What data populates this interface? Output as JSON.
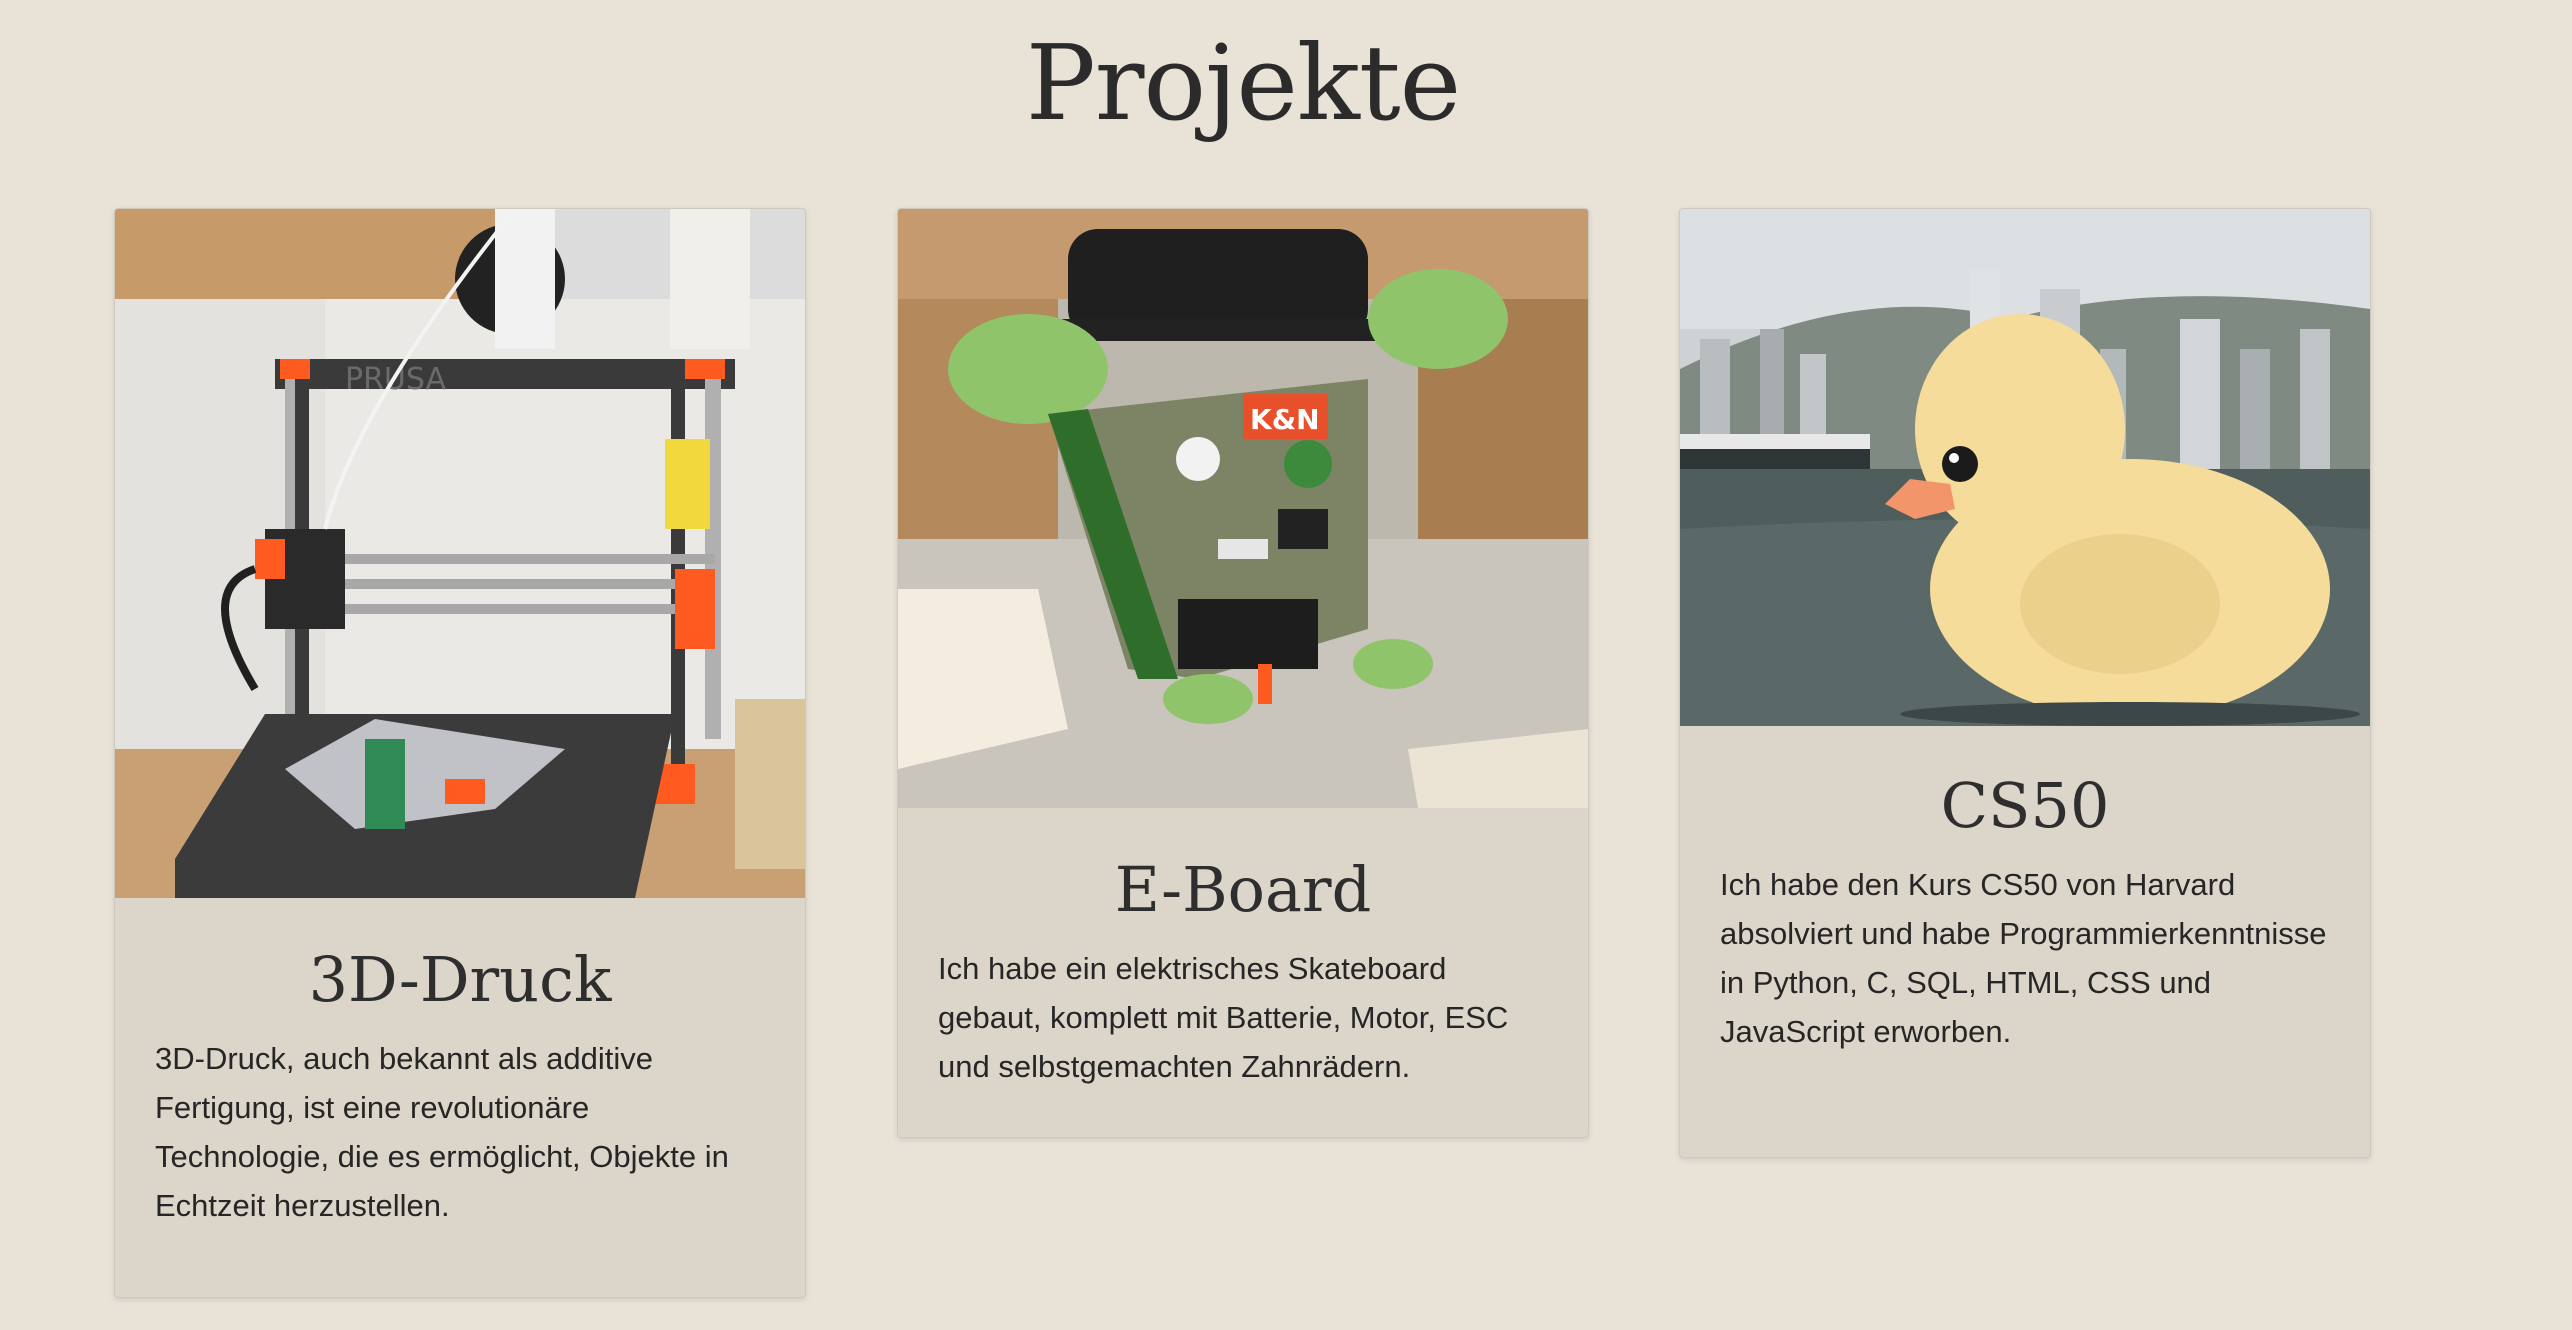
{
  "page": {
    "title": "Projekte"
  },
  "projects": [
    {
      "title": "3D-Druck",
      "text": "3D-Druck, auch bekannt als additive Fertigung, ist eine revolutionäre Technologie, die es ermöglicht, Objekte in Echtzeit herzustellen.",
      "image_label": "PRUSA"
    },
    {
      "title": "E-Board",
      "text": "Ich habe ein elektrisches Skateboard gebaut, komplett mit Batterie, Motor, ESC und selbstgemachten Zahnrädern.",
      "image_label": "K&N"
    },
    {
      "title": "CS50",
      "text": "Ich habe den Kurs CS50 von Harvard absolviert und habe Programmierkenntnisse in Python, C, SQL, HTML, CSS und JavaScript erworben."
    }
  ],
  "colors": {
    "background": "#e8e2d7",
    "card": "#dcd5ca",
    "heading": "#2b2b2b",
    "printer_orange": "#ff5a1f",
    "wheel_green": "#8fc46a",
    "duck_yellow": "#f5dc9a"
  }
}
